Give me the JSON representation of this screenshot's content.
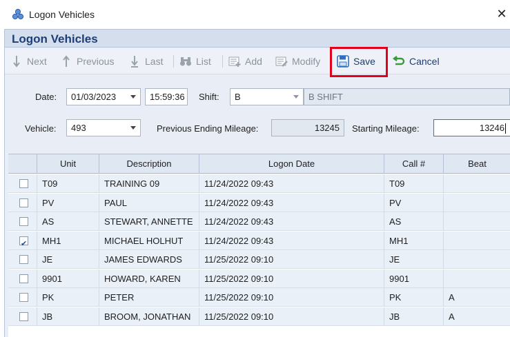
{
  "window": {
    "title": "Logon Vehicles",
    "close_glyph": "✕"
  },
  "panel": {
    "title": "Logon Vehicles"
  },
  "toolbar": {
    "next": "Next",
    "previous": "Previous",
    "last": "Last",
    "list": "List",
    "add": "Add",
    "modify": "Modify",
    "save": "Save",
    "cancel": "Cancel"
  },
  "form": {
    "date_label": "Date:",
    "date_value": "01/03/2023",
    "time_value": "15:59:36",
    "shift_label": "Shift:",
    "shift_value": "B",
    "shift_desc": "B SHIFT",
    "vehicle_label": "Vehicle:",
    "vehicle_value": "493",
    "prev_mileage_label": "Previous Ending Mileage:",
    "prev_mileage_value": "13245",
    "start_mileage_label": "Starting Mileage:",
    "start_mileage_value": "13246"
  },
  "grid": {
    "columns": [
      "Unit",
      "Description",
      "Logon Date",
      "Call #",
      "Beat"
    ],
    "rows": [
      {
        "checked": false,
        "unit": "T09",
        "description": "TRAINING 09",
        "logon_date": "11/24/2022 09:43",
        "call": "T09",
        "beat": ""
      },
      {
        "checked": false,
        "unit": "PV",
        "description": "PAUL",
        "logon_date": "11/24/2022 09:43",
        "call": "PV",
        "beat": ""
      },
      {
        "checked": false,
        "unit": "AS",
        "description": "STEWART, ANNETTE",
        "logon_date": "11/24/2022 09:43",
        "call": "AS",
        "beat": ""
      },
      {
        "checked": true,
        "unit": "MH1",
        "description": "MICHAEL HOLHUT",
        "logon_date": "11/24/2022 09:43",
        "call": "MH1",
        "beat": ""
      },
      {
        "checked": false,
        "unit": "JE",
        "description": "JAMES EDWARDS",
        "logon_date": "11/25/2022 09:10",
        "call": "JE",
        "beat": ""
      },
      {
        "checked": false,
        "unit": "9901",
        "description": "HOWARD, KAREN",
        "logon_date": "11/25/2022 09:10",
        "call": "9901",
        "beat": ""
      },
      {
        "checked": false,
        "unit": "PK",
        "description": "PETER",
        "logon_date": "11/25/2022 09:10",
        "call": "PK",
        "beat": "A"
      },
      {
        "checked": false,
        "unit": "JB",
        "description": "BROOM, JONATHAN",
        "logon_date": "11/25/2022 09:10",
        "call": "JB",
        "beat": "A"
      }
    ]
  },
  "colors": {
    "accent": "#1d3f77",
    "highlight": "#e3001b",
    "save_icon": "#2d6fc4",
    "cancel_icon": "#3a9a3a"
  }
}
